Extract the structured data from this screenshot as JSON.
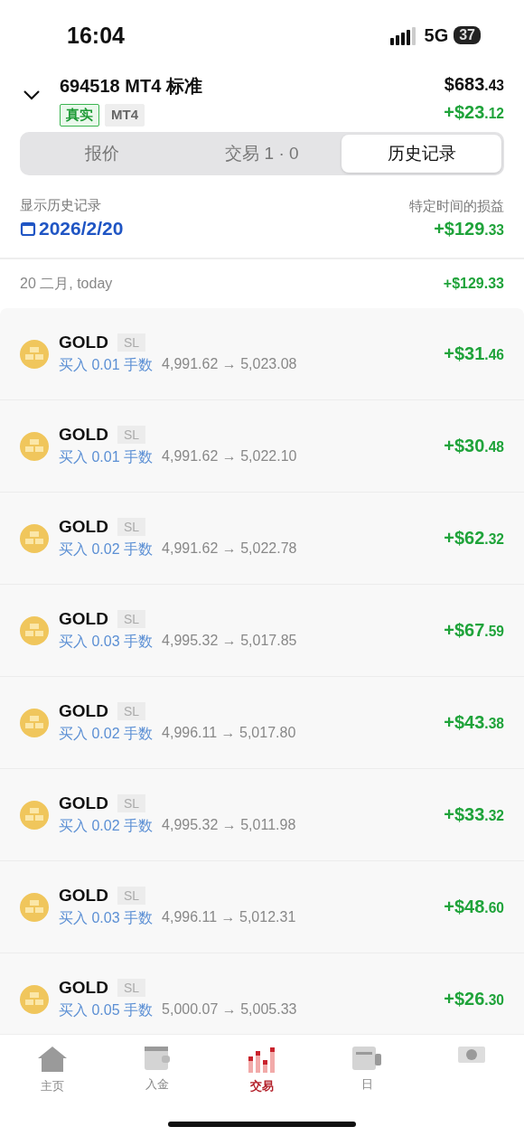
{
  "status_bar": {
    "time": "16:04",
    "network": "5G",
    "battery": "37"
  },
  "account": {
    "title": "694518 MT4 标准",
    "badges": [
      {
        "kind": "live",
        "label": "真实"
      },
      {
        "kind": "platform",
        "label": "MT4"
      }
    ],
    "balance": "$683.43",
    "pnl": "+$23.12"
  },
  "tabs": [
    {
      "label": "报价",
      "selected": false
    },
    {
      "label": "交易 1 · 0",
      "selected": false
    },
    {
      "label": "历史记录",
      "selected": true
    }
  ],
  "history": {
    "label": "显示历史记录",
    "date": "2026/2/20",
    "pnl_label": "特定时间的损益",
    "pnl": "+$129.33"
  },
  "day": {
    "label": "20 二月, today",
    "total": "+$129.33"
  },
  "trades": [
    {
      "symbol": "GOLD",
      "tag": "SL",
      "order": "买入 0.01 手数",
      "prices": "4,991.62 → 5,023.08",
      "profit": "+$31.46"
    },
    {
      "symbol": "GOLD",
      "tag": "SL",
      "order": "买入 0.01 手数",
      "prices": "4,991.62 → 5,022.10",
      "profit": "+$30.48"
    },
    {
      "symbol": "GOLD",
      "tag": "SL",
      "order": "买入 0.02 手数",
      "prices": "4,991.62 → 5,022.78",
      "profit": "+$62.32"
    },
    {
      "symbol": "GOLD",
      "tag": "SL",
      "order": "买入 0.03 手数",
      "prices": "4,995.32 → 5,017.85",
      "profit": "+$67.59"
    },
    {
      "symbol": "GOLD",
      "tag": "SL",
      "order": "买入 0.02 手数",
      "prices": "4,996.11 → 5,017.80",
      "profit": "+$43.38"
    },
    {
      "symbol": "GOLD",
      "tag": "SL",
      "order": "买入 0.02 手数",
      "prices": "4,995.32 → 5,011.98",
      "profit": "+$33.32"
    },
    {
      "symbol": "GOLD",
      "tag": "SL",
      "order": "买入 0.03 手数",
      "prices": "4,996.11 → 5,012.31",
      "profit": "+$48.60"
    },
    {
      "symbol": "GOLD",
      "tag": "SL",
      "order": "买入 0.05 手数",
      "prices": "5,000.07 → 5,005.33",
      "profit": "+$26.30"
    }
  ],
  "tab_bar": [
    {
      "label": "主页",
      "selected": false
    },
    {
      "label": "入金",
      "selected": false
    },
    {
      "label": "交易",
      "selected": true
    },
    {
      "label": "日",
      "selected": false
    },
    {
      "selected": false
    }
  ]
}
